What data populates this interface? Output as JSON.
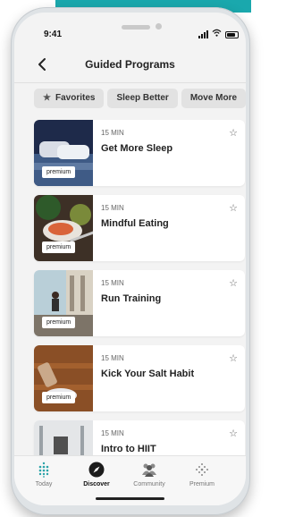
{
  "status": {
    "time": "9:41"
  },
  "header": {
    "title": "Guided Programs"
  },
  "filters": [
    {
      "label": "Favorites",
      "icon": "star-icon"
    },
    {
      "label": "Sleep Better"
    },
    {
      "label": "Move More"
    }
  ],
  "programs": [
    {
      "duration": "15 MIN",
      "title": "Get More Sleep",
      "badge": "premium"
    },
    {
      "duration": "15 MIN",
      "title": "Mindful Eating",
      "badge": "premium"
    },
    {
      "duration": "15 MIN",
      "title": "Run Training",
      "badge": "premium"
    },
    {
      "duration": "15 MIN",
      "title": "Kick Your Salt Habit",
      "badge": "premium"
    },
    {
      "duration": "15 MIN",
      "title": "Intro to HIIT"
    }
  ],
  "tabs": [
    {
      "label": "Today",
      "icon": "dots-grid-icon"
    },
    {
      "label": "Discover",
      "icon": "compass-icon",
      "active": true
    },
    {
      "label": "Community",
      "icon": "people-icon"
    },
    {
      "label": "Premium",
      "icon": "sparkle-grid-icon"
    }
  ],
  "colors": {
    "accent": "#1aa8ad",
    "background": "#f3f3f3",
    "card": "#ffffff"
  }
}
